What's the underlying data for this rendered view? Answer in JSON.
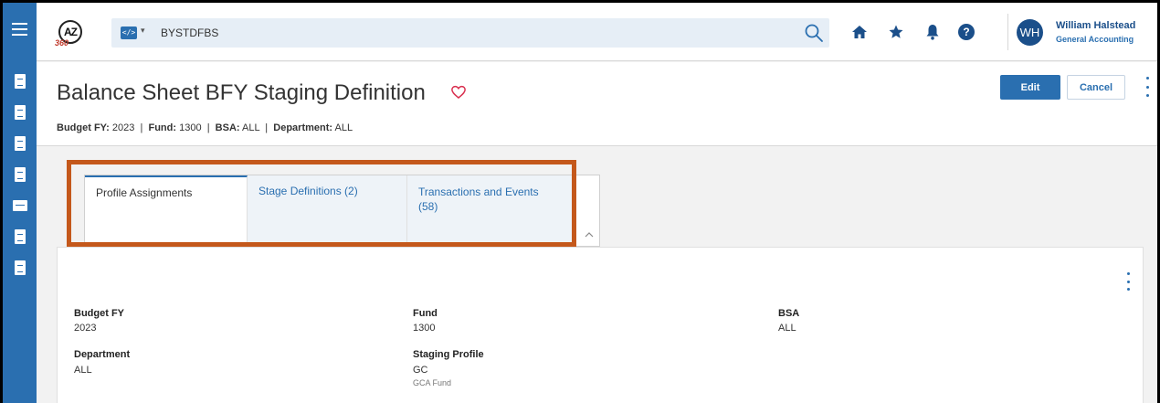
{
  "header": {
    "search_context": "BYSTDFBS",
    "code_chip": "</>",
    "user": {
      "initials": "WH",
      "name": "William Halstead",
      "role": "General Accounting"
    },
    "logo": {
      "text": "AZ",
      "subtext": "360"
    }
  },
  "page": {
    "title": "Balance Sheet BFY Staging Definition",
    "summary": [
      {
        "label": "Budget FY:",
        "value": "2023"
      },
      {
        "label": "Fund:",
        "value": "1300"
      },
      {
        "label": "BSA:",
        "value": "ALL"
      },
      {
        "label": "Department:",
        "value": "ALL"
      }
    ],
    "edit_label": "Edit",
    "cancel_label": "Cancel"
  },
  "tabs": [
    {
      "label": "Profile Assignments"
    },
    {
      "label": "Stage Definitions (2)"
    },
    {
      "label": "Transactions and Events (58)"
    }
  ],
  "fields": {
    "budget_fy": {
      "label": "Budget FY",
      "value": "2023"
    },
    "fund": {
      "label": "Fund",
      "value": "1300"
    },
    "bsa": {
      "label": "BSA",
      "value": "ALL"
    },
    "department": {
      "label": "Department",
      "value": "ALL"
    },
    "staging_profile": {
      "label": "Staging Profile",
      "value": "GC",
      "sub": "GCA Fund"
    }
  },
  "colors": {
    "brand_blue": "#2a6fb0",
    "dark_blue": "#1b4f8a",
    "highlight": "#c4581b",
    "favorite": "#d9304f"
  }
}
